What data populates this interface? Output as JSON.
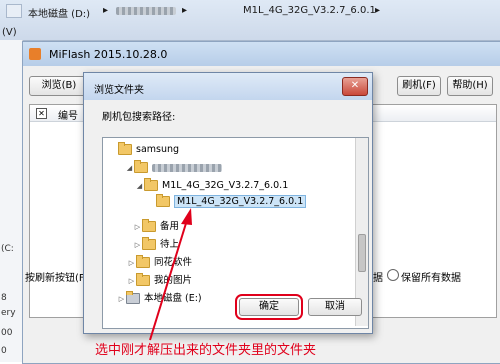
{
  "explorer": {
    "path_drive": "本地磁盘 (D:)",
    "path_sep1": "▸",
    "path_sep2": "▸",
    "path_folder": "M1L_4G_32G_V3.2.7_6.0.1",
    "path_sep3": "▸",
    "menu_fragment": "(V)"
  },
  "left_strip": {
    "item1": "(C:",
    "item2": "8",
    "item3": "ery",
    "item4": "00",
    "item5": "0"
  },
  "miflash": {
    "title": "MiFlash 2015.10.28.0",
    "browse_button": "浏览(B)",
    "browse_arrow": "▾",
    "flash_button": "刷机(F)",
    "help_button": "帮助(H)",
    "col_number": "编号",
    "bottom_left_text": "按刷新按钮(F5)刷",
    "bottom_mid_text": "据",
    "keep_all_label": "保留所有数据"
  },
  "dialog": {
    "title": "浏览文件夹",
    "close_symbol": "✕",
    "prompt": "刷机包搜索路径:",
    "tree": [
      {
        "label": "samsung"
      },
      {
        "label": ""
      },
      {
        "label": "M1L_4G_32G_V3.2.7_6.0.1"
      },
      {
        "label": "M1L_4G_32G_V3.2.7_6.0.1"
      },
      {
        "label": "备用"
      },
      {
        "label": "待上"
      },
      {
        "label": "同花"
      },
      {
        "label": "软件"
      },
      {
        "label": "我的图片"
      },
      {
        "label": "本地磁盘 (E:)"
      }
    ],
    "ok_button": "确定",
    "cancel_button": "取消"
  },
  "annotation": {
    "text": "选中刚才解压出来的文件夹里的文件夹",
    "color": "#e0001b"
  }
}
